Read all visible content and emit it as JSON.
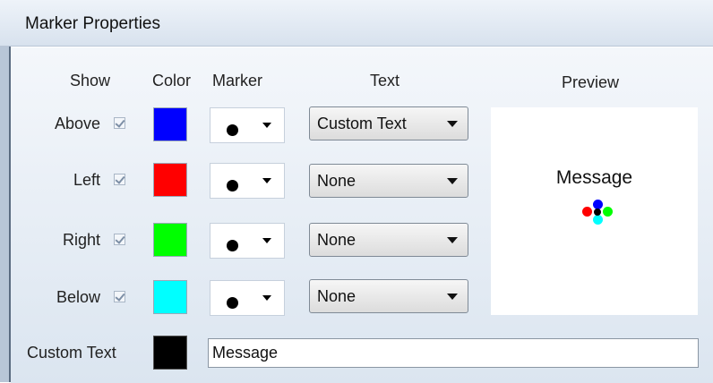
{
  "window": {
    "title": "Marker Properties"
  },
  "headers": {
    "show": "Show",
    "color": "Color",
    "marker": "Marker",
    "text": "Text",
    "preview": "Preview"
  },
  "rows": [
    {
      "label": "Above",
      "checked": true,
      "color": "#0000ff",
      "marker_icon": "filled-circle-icon",
      "text_option": "Custom Text"
    },
    {
      "label": "Left",
      "checked": true,
      "color": "#ff0000",
      "marker_icon": "filled-circle-icon",
      "text_option": "None"
    },
    {
      "label": "Right",
      "checked": true,
      "color": "#00ff00",
      "marker_icon": "filled-circle-icon",
      "text_option": "None"
    },
    {
      "label": "Below",
      "checked": true,
      "color": "#00ffff",
      "marker_icon": "filled-circle-icon",
      "text_option": "None"
    }
  ],
  "preview": {
    "message": "Message"
  },
  "custom_text": {
    "label": "Custom Text",
    "color": "#000000",
    "value": "Message"
  }
}
